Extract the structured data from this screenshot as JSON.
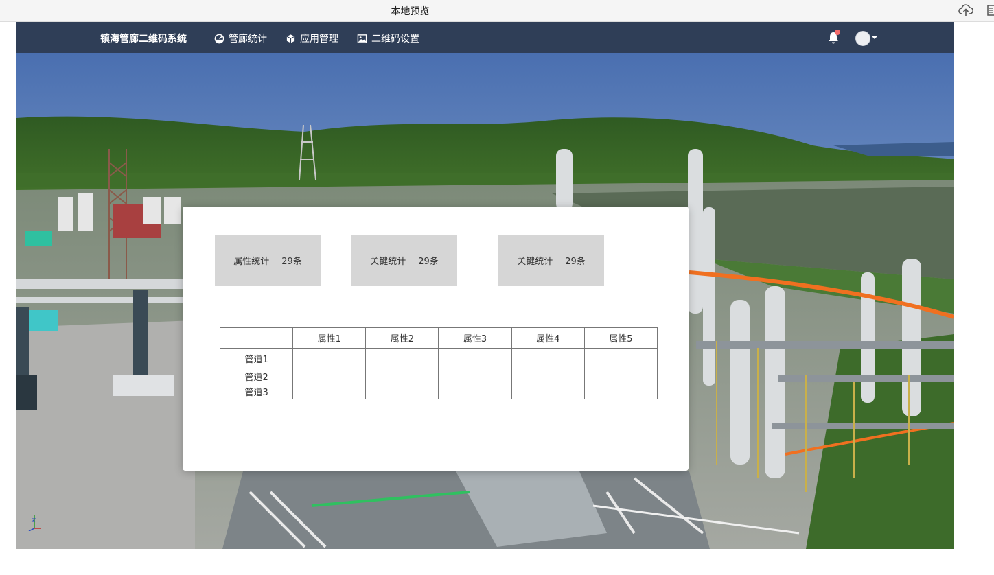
{
  "window": {
    "title": "本地预览"
  },
  "navbar": {
    "brand": "镇海管廊二维码系统",
    "items": [
      {
        "label": "管廊统计",
        "icon": "dashboard-icon"
      },
      {
        "label": "应用管理",
        "icon": "cube-icon"
      },
      {
        "label": "二维码设置",
        "icon": "image-icon"
      }
    ],
    "notification_icon": "bell-icon",
    "avatar_icon": "user-avatar-icon"
  },
  "panel": {
    "cards": [
      {
        "label": "属性统计",
        "value": "29条"
      },
      {
        "label": "关键统计",
        "value": "29条"
      },
      {
        "label": "关键统计",
        "value": "29条"
      }
    ],
    "table": {
      "columns": [
        "",
        "属性1",
        "属性2",
        "属性3",
        "属性4",
        "属性5"
      ],
      "rows": [
        {
          "name": "管道1",
          "cells": [
            "",
            "",
            "",
            "",
            ""
          ]
        },
        {
          "name": "管道2",
          "cells": [
            "",
            "",
            "",
            "",
            ""
          ]
        },
        {
          "name": "管道3",
          "cells": [
            "",
            "",
            "",
            "",
            ""
          ]
        }
      ]
    }
  },
  "colors": {
    "navbar": "#2f3e57",
    "card": "#d6d6d6",
    "notification_dot": "#f56c6c"
  }
}
